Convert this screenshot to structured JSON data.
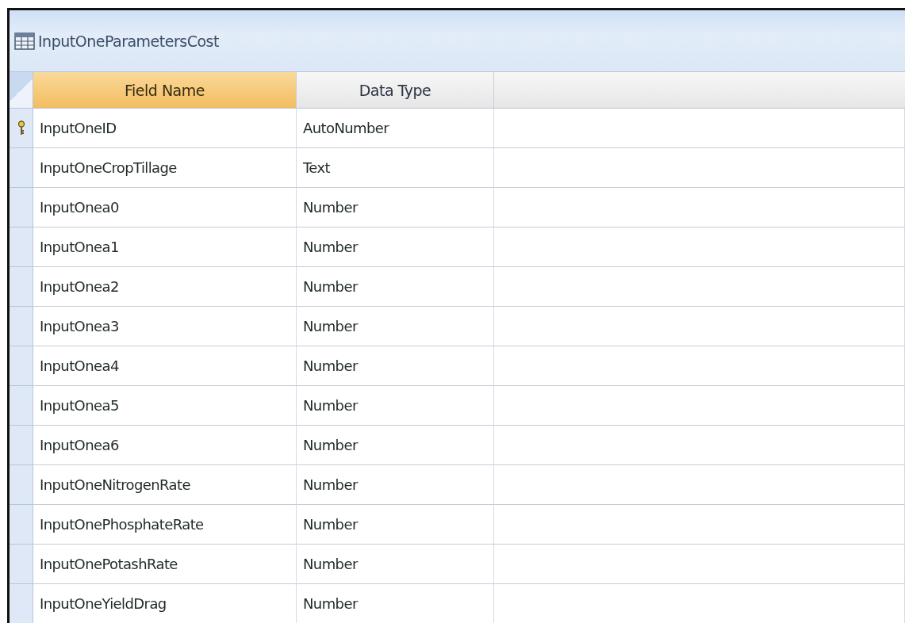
{
  "window": {
    "title": "InputOneParametersCost"
  },
  "table": {
    "columns": [
      {
        "label": "Field Name",
        "selected": true
      },
      {
        "label": "Data Type",
        "selected": false
      }
    ],
    "rows": [
      {
        "field_name": "InputOneID",
        "data_type": "AutoNumber",
        "primary_key": true
      },
      {
        "field_name": "InputOneCropTillage",
        "data_type": "Text",
        "primary_key": false
      },
      {
        "field_name": "InputOnea0",
        "data_type": "Number",
        "primary_key": false
      },
      {
        "field_name": "InputOnea1",
        "data_type": "Number",
        "primary_key": false
      },
      {
        "field_name": "InputOnea2",
        "data_type": "Number",
        "primary_key": false
      },
      {
        "field_name": "InputOnea3",
        "data_type": "Number",
        "primary_key": false
      },
      {
        "field_name": "InputOnea4",
        "data_type": "Number",
        "primary_key": false
      },
      {
        "field_name": "InputOnea5",
        "data_type": "Number",
        "primary_key": false
      },
      {
        "field_name": "InputOnea6",
        "data_type": "Number",
        "primary_key": false
      },
      {
        "field_name": "InputOneNitrogenRate",
        "data_type": "Number",
        "primary_key": false
      },
      {
        "field_name": "InputOnePhosphateRate",
        "data_type": "Number",
        "primary_key": false
      },
      {
        "field_name": "InputOnePotashRate",
        "data_type": "Number",
        "primary_key": false
      },
      {
        "field_name": "InputOneYieldDrag",
        "data_type": "Number",
        "primary_key": false
      }
    ]
  }
}
